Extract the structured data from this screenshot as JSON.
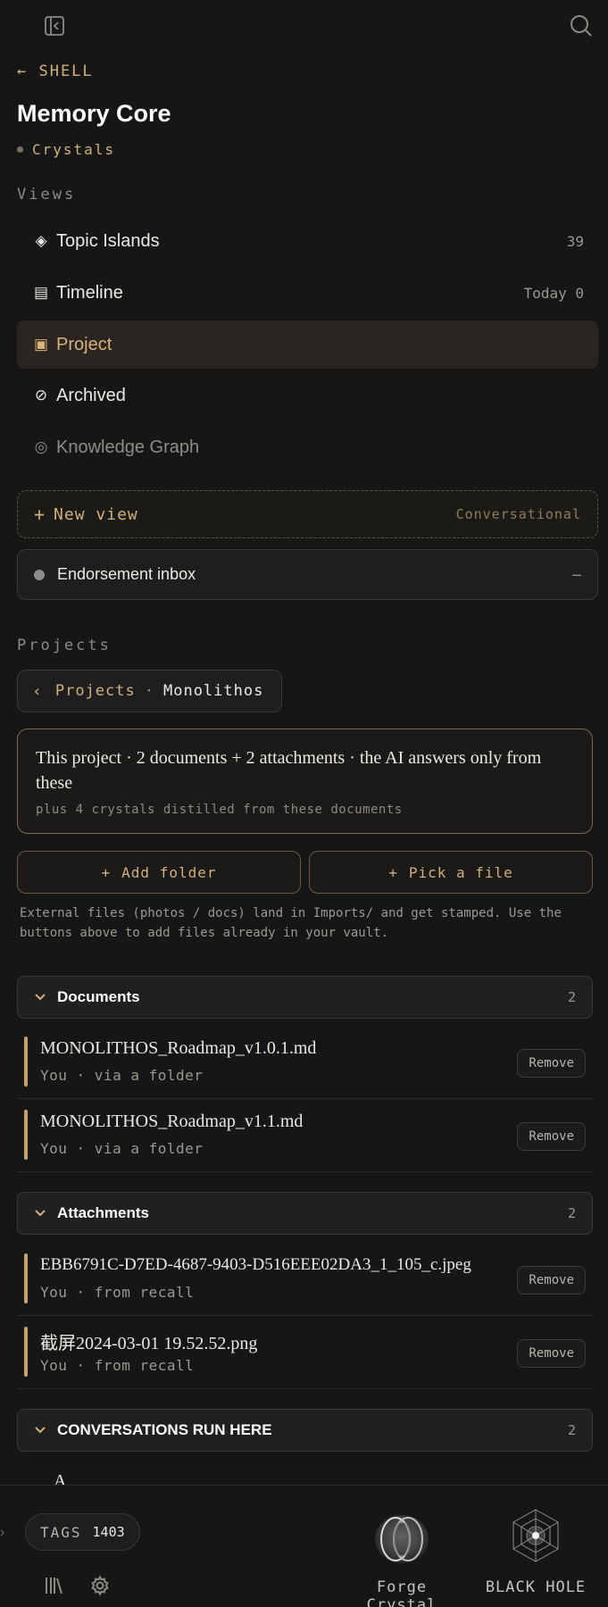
{
  "header": {
    "sidebar_toggle_icon": "sidebar-collapse-icon",
    "search_icon": "search-icon"
  },
  "back_link": "← SHELL",
  "title": "Memory Core",
  "subtitle": "Crystals",
  "views": {
    "label": "Views",
    "items": [
      {
        "icon": "◈",
        "label": "Topic Islands",
        "count": "39",
        "state": "normal"
      },
      {
        "icon": "▤",
        "label": "Timeline",
        "count": "Today 0",
        "state": "normal"
      },
      {
        "icon": "▣",
        "label": "Project",
        "count": "",
        "state": "active"
      },
      {
        "icon": "⊘",
        "label": "Archived",
        "count": "",
        "state": "normal"
      },
      {
        "icon": "◎",
        "label": "Knowledge Graph",
        "count": "",
        "state": "muted"
      }
    ],
    "new_view": {
      "plus": "+",
      "label": "New view",
      "mode": "Conversational"
    }
  },
  "inbox": {
    "label": "Endorsement inbox",
    "value": "–"
  },
  "projects": {
    "label": "Projects",
    "breadcrumb": {
      "chevron": "‹",
      "root": "Projects",
      "sep": "·",
      "current": "Monolithos"
    },
    "info": {
      "line1": "This project · 2 documents + 2 attachments · the AI answers only from these",
      "line2": "plus 4 crystals distilled from these documents"
    },
    "add_folder": "Add folder",
    "pick_file": "Pick a file",
    "hint": "External files (photos / docs) land in Imports/ and get stamped. Use the buttons above to add files already in your vault."
  },
  "groups": {
    "documents": {
      "title": "Documents",
      "count": "2"
    },
    "attachments": {
      "title": "Attachments",
      "count": "2"
    },
    "conversations": {
      "title": "CONVERSATIONS RUN HERE",
      "count": "2"
    }
  },
  "documents": [
    {
      "name": "MONOLITHOS_Roadmap_v1.0.1.md",
      "meta": "You · via a folder",
      "action": "Remove"
    },
    {
      "name": "MONOLITHOS_Roadmap_v1.1.md",
      "meta": "You · via a folder",
      "action": "Remove"
    }
  ],
  "attachments": [
    {
      "name": "EBB6791C-D7ED-4687-9403-D516EEE02DA3_1_105_c.jpeg",
      "meta": "You · from recall",
      "action": "Remove"
    },
    {
      "name": "截屏2024-03-01 19.52.52.png",
      "meta": "You · from recall",
      "action": "Remove"
    }
  ],
  "partial_text": "A",
  "bottom": {
    "tags_label": "TAGS",
    "tags_count": "1403",
    "forge_label": "Forge Crystal",
    "blackhole_label": "BLACK HOLE"
  },
  "colors": {
    "accent": "#d1b07a",
    "background": "#161616"
  }
}
